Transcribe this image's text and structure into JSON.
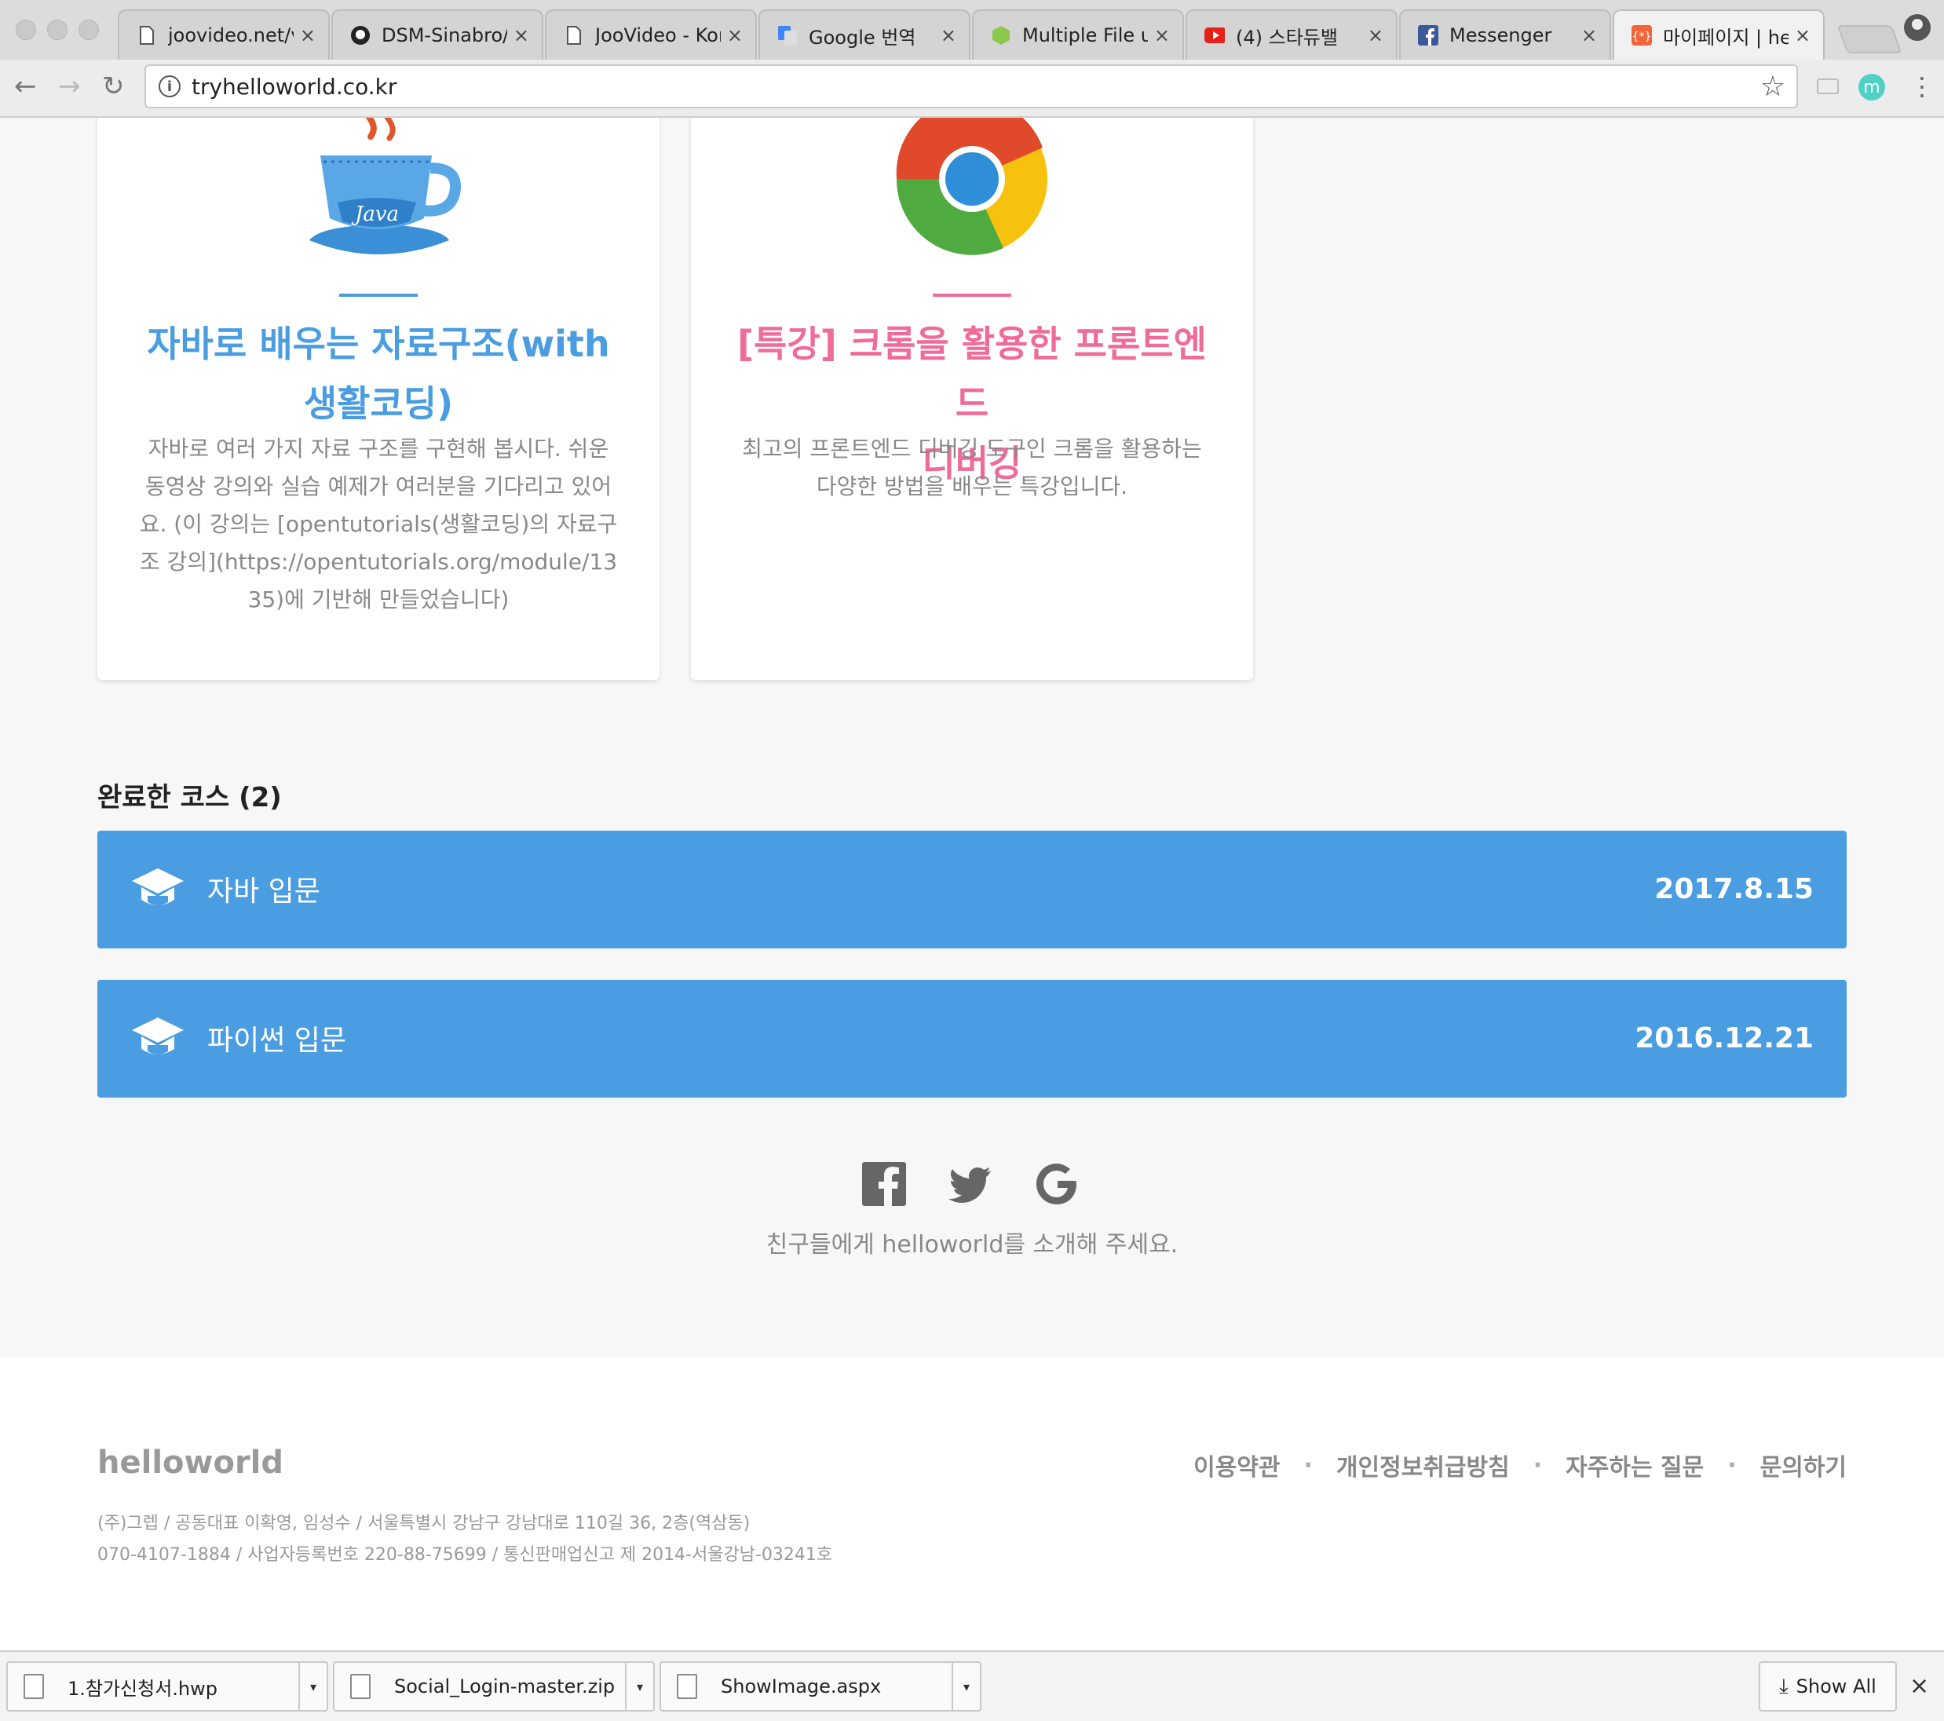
{
  "browser": {
    "tabs": [
      {
        "title": "joovideo.net/v",
        "favicon": "document-icon",
        "active": false
      },
      {
        "title": "DSM-Sinabro/",
        "favicon": "github-icon",
        "active": false
      },
      {
        "title": "JooVideo - Kor",
        "favicon": "document-icon",
        "active": false
      },
      {
        "title": "Google 번역",
        "favicon": "google-translate-icon",
        "active": false
      },
      {
        "title": "Multiple File u",
        "favicon": "nodejs-icon",
        "active": false
      },
      {
        "title": "(4) 스타듀밸",
        "favicon": "youtube-icon",
        "active": false
      },
      {
        "title": "Messenger",
        "favicon": "facebook-icon",
        "active": false
      },
      {
        "title": "마이페이지 | hell",
        "favicon": "helloworld-icon",
        "active": true
      }
    ],
    "close_glyph": "×",
    "url": "tryhelloworld.co.kr",
    "extension_letter": "m"
  },
  "cards": [
    {
      "title_line1": "자바로 배우는 자료구조(with",
      "title_line2": "생활코딩)",
      "description_lines": [
        "자바로 여러 가지 자료 구조를 구현해 봅시다. 쉬운",
        "동영상 강의와 실습 예제가 여러분을 기다리고 있어",
        "요. (이 강의는 [opentutorials(생활코딩)의 자료구",
        "조 강의](https://opentutorials.org/module/13",
        "35)에 기반해 만들었습니다)"
      ],
      "color": "#4a9de0",
      "illustration": "java-cup-icon",
      "illustration_text": "Java"
    },
    {
      "title_line1": "[특강] 크롬을 활용한 프론트엔드",
      "title_line2": "디버깅",
      "description_lines": [
        "최고의 프론트엔드 디버깅 도구인 크롬을 활용하는",
        "다양한 방법을 배우는 특강입니다."
      ],
      "color": "#ef6b9a",
      "illustration": "chrome-logo-icon"
    }
  ],
  "completed": {
    "heading": "완료한 코스 (2)",
    "courses": [
      {
        "name": "자바 입문",
        "date": "2017.8.15"
      },
      {
        "name": "파이썬 입문",
        "date": "2016.12.21"
      }
    ],
    "bar_color": "#4a9de0"
  },
  "share": {
    "icons": [
      "facebook-icon",
      "twitter-icon",
      "google-icon"
    ],
    "text": "친구들에게 helloworld를 소개해 주세요."
  },
  "footer": {
    "logo": "helloworld",
    "links": [
      "이용약관",
      "개인정보취급방침",
      "자주하는 질문",
      "문의하기"
    ],
    "separator": "·",
    "line1": "(주)그렙 / 공동대표 이확영, 임성수 / 서울특별시 강남구 강남대로 110길 36, 2층(역삼동)",
    "line2": "070-4107-1884 / 사업자등록번호 220-88-75699 / 통신판매업신고 제 2014-서울강남-03241호"
  },
  "downloads": {
    "items": [
      {
        "name": "1.참가신청서.hwp"
      },
      {
        "name": "Social_Login-master.zip"
      },
      {
        "name": "ShowImage.aspx"
      }
    ],
    "show_all_label": "Show All"
  }
}
